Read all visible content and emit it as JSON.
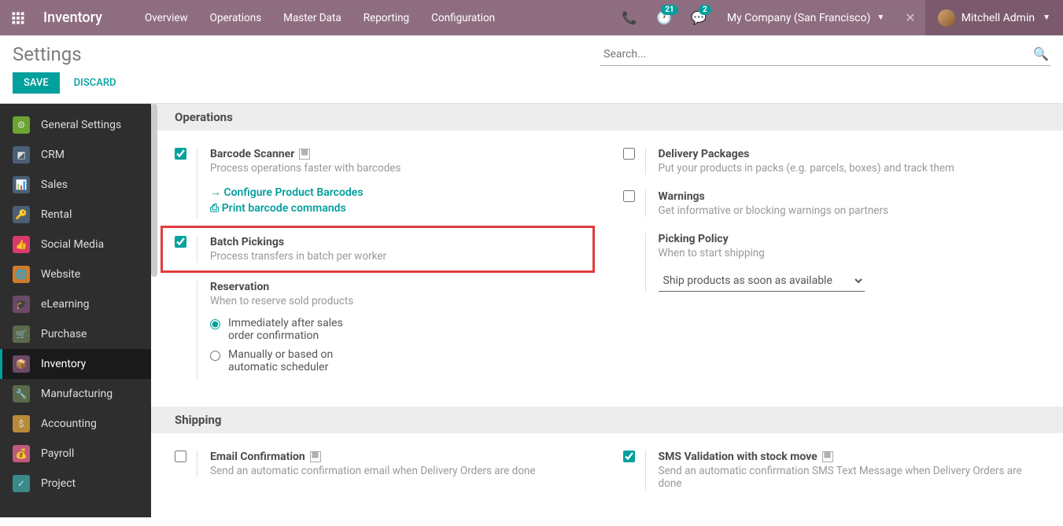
{
  "navbar": {
    "brand": "Inventory",
    "menu": [
      "Overview",
      "Operations",
      "Master Data",
      "Reporting",
      "Configuration"
    ],
    "activity_badge": "21",
    "chat_badge": "2",
    "company": "My Company (San Francisco)",
    "user": "Mitchell Admin"
  },
  "page": {
    "title": "Settings",
    "search_placeholder": "Search...",
    "save": "SAVE",
    "discard": "DISCARD"
  },
  "sidebar": [
    {
      "label": "General Settings",
      "color": "#6ca332",
      "glyph": "⚙"
    },
    {
      "label": "CRM",
      "color": "#4b5f76",
      "glyph": "◩"
    },
    {
      "label": "Sales",
      "color": "#4b5f76",
      "glyph": "📊"
    },
    {
      "label": "Rental",
      "color": "#4b5f76",
      "glyph": "🔑"
    },
    {
      "label": "Social Media",
      "color": "#d83a6c",
      "glyph": "👍"
    },
    {
      "label": "Website",
      "color": "#d07a2b",
      "glyph": "🌐"
    },
    {
      "label": "eLearning",
      "color": "#6b4a68",
      "glyph": "🎓"
    },
    {
      "label": "Purchase",
      "color": "#5a6a4a",
      "glyph": "🛒"
    },
    {
      "label": "Inventory",
      "color": "#6b4a68",
      "glyph": "📦",
      "active": true
    },
    {
      "label": "Manufacturing",
      "color": "#5a6a4a",
      "glyph": "🔧"
    },
    {
      "label": "Accounting",
      "color": "#b88a3a",
      "glyph": "$"
    },
    {
      "label": "Payroll",
      "color": "#c05a7a",
      "glyph": "💰"
    },
    {
      "label": "Project",
      "color": "#3a8a8a",
      "glyph": "✓"
    }
  ],
  "sections": {
    "operations": {
      "title": "Operations",
      "left": {
        "barcode": {
          "title": "Barcode Scanner",
          "desc": "Process operations faster with barcodes",
          "link1": "Configure Product Barcodes",
          "link2": "Print barcode commands",
          "checked": true
        },
        "batch": {
          "title": "Batch Pickings",
          "desc": "Process transfers in batch per worker",
          "checked": true
        },
        "reservation": {
          "title": "Reservation",
          "desc": "When to reserve sold products",
          "opt1": "Immediately after sales order confirmation",
          "opt2": "Manually or based on automatic scheduler"
        }
      },
      "right": {
        "packages": {
          "title": "Delivery Packages",
          "desc": "Put your products in packs (e.g. parcels, boxes) and track them",
          "checked": false
        },
        "warnings": {
          "title": "Warnings",
          "desc": "Get informative or blocking warnings on partners",
          "checked": false
        },
        "policy": {
          "title": "Picking Policy",
          "desc": "When to start shipping",
          "select": "Ship products as soon as available"
        }
      }
    },
    "shipping": {
      "title": "Shipping",
      "left": {
        "email": {
          "title": "Email Confirmation",
          "desc": "Send an automatic confirmation email when Delivery Orders are done",
          "checked": false
        }
      },
      "right": {
        "sms": {
          "title": "SMS Validation with stock move",
          "desc": "Send an automatic confirmation SMS Text Message when Delivery Orders are done",
          "checked": true
        }
      }
    }
  }
}
